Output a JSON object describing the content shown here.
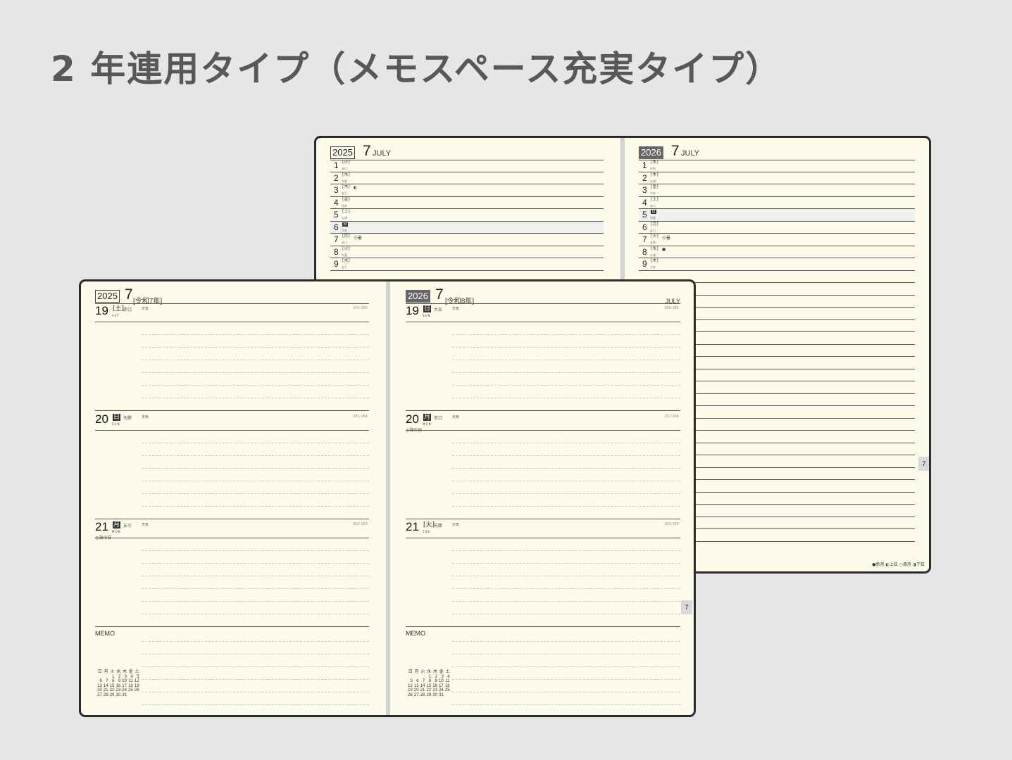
{
  "header": {
    "title": "2 年連用タイプ（メモスペース充実タイプ）"
  },
  "back_book": {
    "left_page": {
      "year": "2025",
      "month": "7",
      "month_en": "JULY",
      "rows": [
        {
          "n": "1",
          "wd": "[火]",
          "rk": "赤口"
        },
        {
          "n": "2",
          "wd": "[水]",
          "rk": "先勝"
        },
        {
          "n": "3",
          "wd": "[木]",
          "rk": "友引",
          "note": "◐"
        },
        {
          "n": "4",
          "wd": "[金]",
          "rk": "先負"
        },
        {
          "n": "5",
          "wd": "[土]",
          "rk": "仏滅"
        },
        {
          "n": "6",
          "wd": "日",
          "rk": "大安",
          "hl": true
        },
        {
          "n": "7",
          "wd": "[月]",
          "rk": "赤口",
          "note": "小暑"
        },
        {
          "n": "8",
          "wd": "[火]",
          "rk": "先勝"
        },
        {
          "n": "9",
          "wd": "[水]",
          "rk": "友引"
        }
      ]
    },
    "right_page": {
      "year": "2026",
      "month": "7",
      "month_en": "JULY",
      "rows": [
        {
          "n": "1",
          "wd": "[水]",
          "rk": "先負"
        },
        {
          "n": "2",
          "wd": "[木]",
          "rk": "仏滅"
        },
        {
          "n": "3",
          "wd": "[金]",
          "rk": "大安"
        },
        {
          "n": "4",
          "wd": "[土]",
          "rk": "赤口"
        },
        {
          "n": "5",
          "wd": "日",
          "rk": "先勝",
          "hl": true
        },
        {
          "n": "6",
          "wd": "[月]",
          "rk": "友引"
        },
        {
          "n": "7",
          "wd": "[火]",
          "rk": "先負",
          "note": "小暑"
        },
        {
          "n": "8",
          "wd": "[水]",
          "rk": "仏滅",
          "note": "●"
        },
        {
          "n": "9",
          "wd": "[木]",
          "rk": "大安"
        }
      ],
      "tab_label": "7",
      "moon_legend": "●新月 ◐上弦 ○満月 ◑下弦"
    }
  },
  "front_book": {
    "left_page": {
      "year": "2025",
      "month": "7",
      "era": "[令和7年]",
      "days": [
        {
          "num": "19",
          "wd": "[土]",
          "en": "SAT",
          "rk": "赤口",
          "weather": "天気",
          "count": "200-165"
        },
        {
          "num": "20",
          "wd": "日",
          "en": "SUN",
          "rk": "先勝",
          "weather": "天気",
          "count": "201-164"
        },
        {
          "num": "21",
          "wd": "月",
          "en": "MON",
          "rk": "友引",
          "weather": "天気",
          "count": "202-163",
          "holiday": "◎海の日"
        }
      ],
      "memo": "MEMO",
      "cal": [
        [
          "日",
          "月",
          "火",
          "水",
          "木",
          "金",
          "土"
        ],
        [
          "",
          "",
          "1",
          "2",
          "3",
          "4",
          "5"
        ],
        [
          "6",
          "7",
          "8",
          "9",
          "10",
          "11",
          "12"
        ],
        [
          "13",
          "14",
          "15",
          "16",
          "17",
          "18",
          "19"
        ],
        [
          "20",
          "21",
          "22",
          "23",
          "24",
          "25",
          "26"
        ],
        [
          "27",
          "28",
          "29",
          "30",
          "31",
          "",
          ""
        ]
      ]
    },
    "right_page": {
      "year": "2026",
      "month": "7",
      "era": "[令和8年]",
      "month_en": "JULY",
      "days": [
        {
          "num": "19",
          "wd": "日",
          "en": "SUN",
          "rk": "大安",
          "weather": "天気",
          "count": "200-165"
        },
        {
          "num": "20",
          "wd": "月",
          "en": "MON",
          "rk": "赤口",
          "weather": "天気",
          "count": "201-164",
          "holiday": "◎海の日"
        },
        {
          "num": "21",
          "wd": "[火]",
          "en": "TUE",
          "rk": "先勝",
          "weather": "天気",
          "count": "202-163"
        }
      ],
      "memo": "MEMO",
      "tab_label": "7",
      "cal": [
        [
          "日",
          "月",
          "火",
          "水",
          "木",
          "金",
          "土"
        ],
        [
          "",
          "",
          "",
          "1",
          "2",
          "3",
          "4"
        ],
        [
          "5",
          "6",
          "7",
          "8",
          "9",
          "10",
          "11"
        ],
        [
          "12",
          "13",
          "14",
          "15",
          "16",
          "17",
          "18"
        ],
        [
          "19",
          "20",
          "21",
          "22",
          "23",
          "24",
          "25"
        ],
        [
          "26",
          "27",
          "28",
          "29",
          "30",
          "31",
          ""
        ]
      ]
    }
  }
}
